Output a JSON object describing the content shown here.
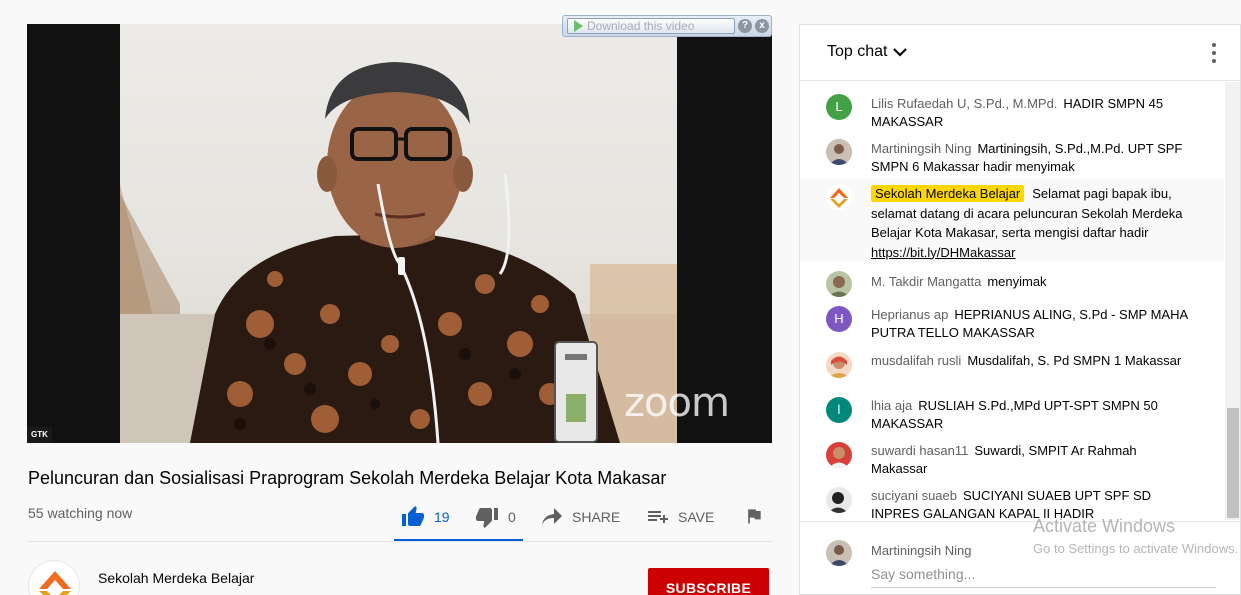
{
  "video": {
    "corner_label": "GTK",
    "watermark_logo": "zoom",
    "download_bar": {
      "label": "Download this video",
      "help": "?",
      "close": "x"
    }
  },
  "info": {
    "title": "Peluncuran dan Sosialisasi Praprogram Sekolah Merdeka Belajar Kota Makasar",
    "watching": "55 watching now",
    "likes": "19",
    "dislikes": "0",
    "share_label": "SHARE",
    "save_label": "SAVE",
    "accent_color": "#065fd4"
  },
  "channel": {
    "name": "Sekolah Merdeka Belajar",
    "subscribe_label": "SUBSCRIBE",
    "subscribe_color": "#cc0000"
  },
  "chat": {
    "title": "Top chat",
    "messages": [
      {
        "author": "Lilis Rufaedah U, S.Pd., M.MPd.",
        "text": "HADIR SMPN 45 MAKASSAR",
        "avatar_letter": "L",
        "avatar_color": "#43a047"
      },
      {
        "author": "Martiningsih Ning",
        "text": "Martiningsih, S.Pd.,M.Pd. UPT SPF SMPN 6 Makassar hadir menyimak",
        "avatar_icon": "photo-avatar"
      },
      {
        "author": "Sekolah Merdeka Belajar",
        "text": "Selamat pagi bapak ibu, selamat datang di acara peluncuran Sekolah Merdeka Belajar Kota Makasar, serta mengisi daftar hadir",
        "link": "https://bit.ly/DHMakassar",
        "owner": true,
        "avatar_icon": "channel-logo"
      },
      {
        "author": "M. Takdir Mangatta",
        "text": "menyimak",
        "avatar_icon": "photo-avatar"
      },
      {
        "author": "Heprianus ap",
        "text": "HEPRIANUS ALING, S.Pd - SMP MAHA PUTRA TELLO MAKASSAR",
        "avatar_letter": "H",
        "avatar_color": "#7e57c2"
      },
      {
        "author": "musdalifah rusli",
        "text": "Musdalifah, S. Pd SMPN 1 Makassar",
        "avatar_icon": "photo-avatar"
      },
      {
        "author": "lhia aja",
        "text": "RUSLIAH S.Pd.,MPd UPT-SPT SMPN 50 MAKASSAR",
        "avatar_letter": "l",
        "avatar_color": "#00897b"
      },
      {
        "author": "suwardi hasan11",
        "text": "Suwardi, SMPIT Ar Rahmah Makassar",
        "avatar_icon": "photo-avatar"
      },
      {
        "author": "suciyani suaeb",
        "text": "SUCIYANI SUAEB UPT SPF SD INPRES GALANGAN KAPAL II HADIR",
        "avatar_icon": "photo-avatar"
      }
    ],
    "composer": {
      "name": "Martiningsih Ning",
      "placeholder": "Say something..."
    }
  },
  "os_watermark": {
    "line1": "Activate Windows",
    "line2": "Go to Settings to activate Windows."
  }
}
